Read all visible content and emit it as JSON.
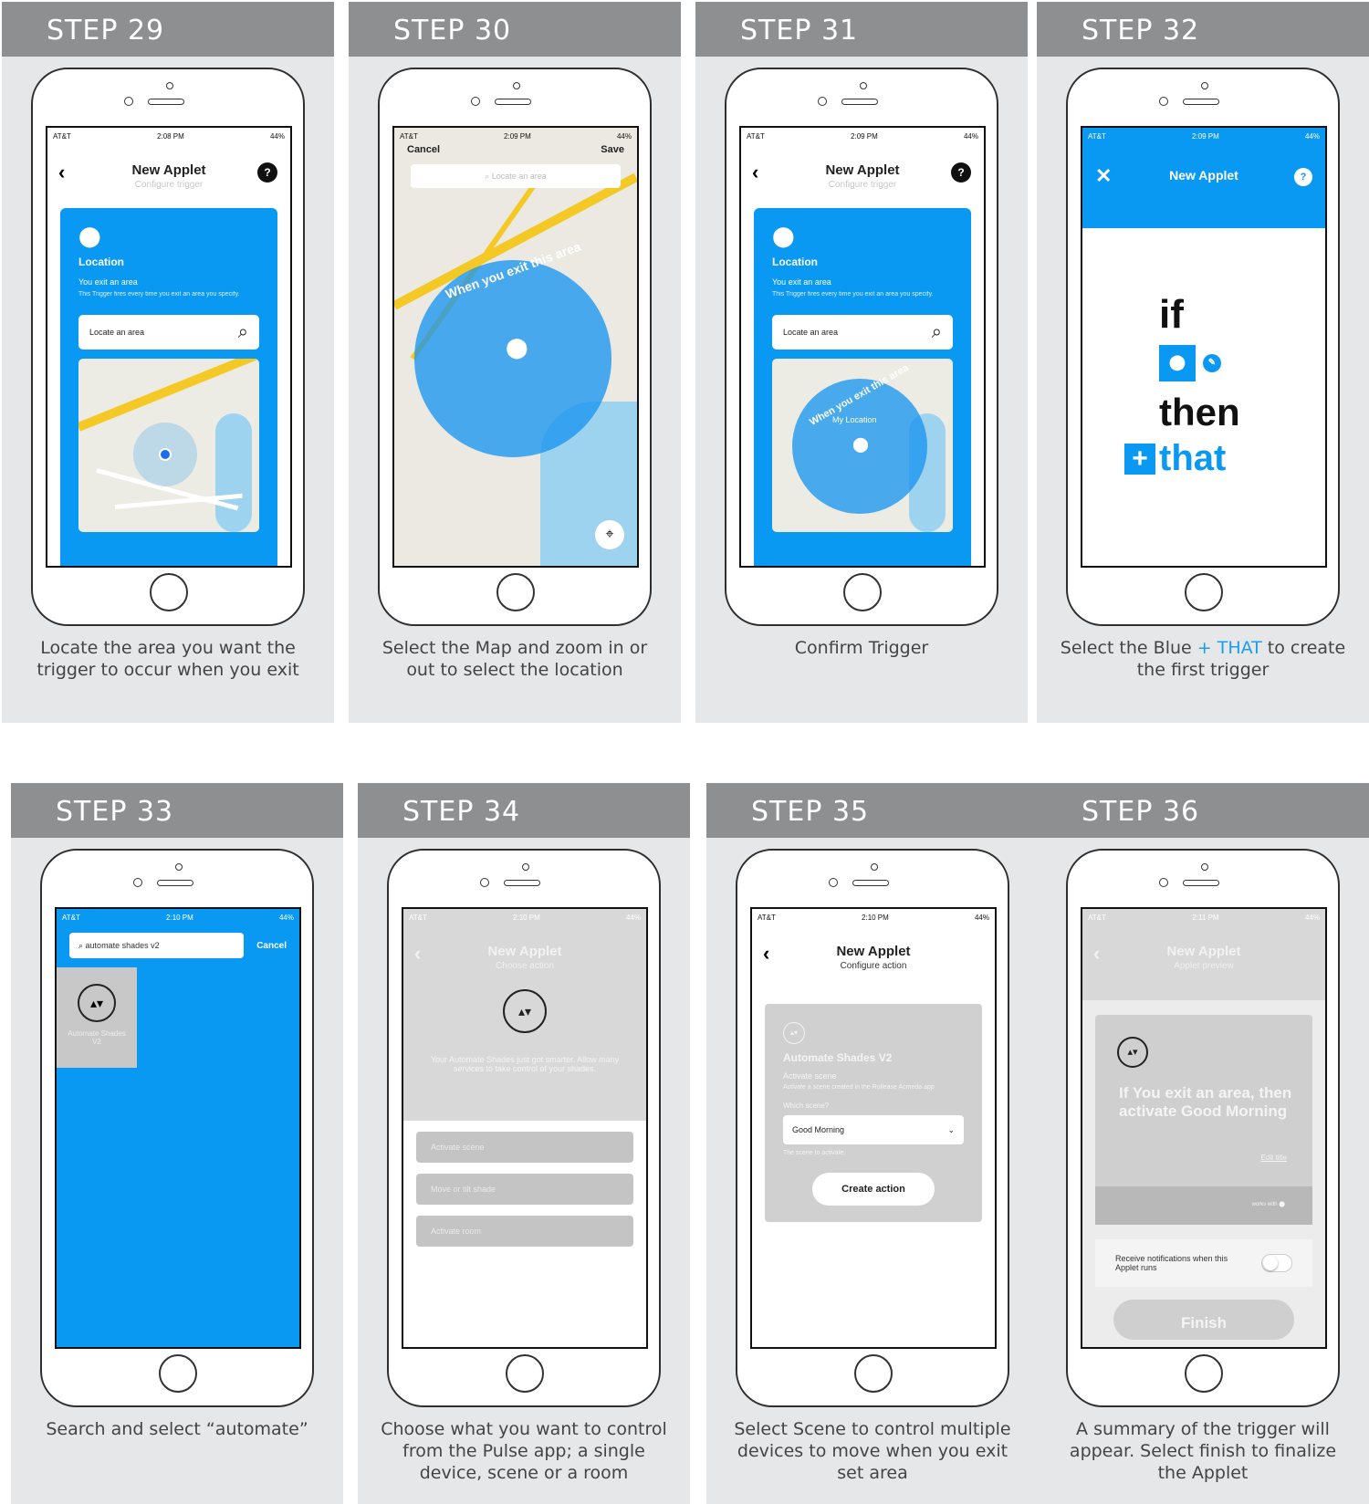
{
  "steps": [
    {
      "label": "STEP 29",
      "caption": "Locate the area you want the trigger to occur when you exit"
    },
    {
      "label": "STEP 30",
      "caption": "Select the Map and zoom in or out to select the location"
    },
    {
      "label": "STEP 31",
      "caption": "Confirm Trigger"
    },
    {
      "label": "STEP 32",
      "caption_pre": "Select the Blue ",
      "caption_accent": "+ THAT",
      "caption_post": " to create the first trigger"
    },
    {
      "label": "STEP 33",
      "caption": "Search and select “automate”"
    },
    {
      "label": "STEP 34",
      "caption": "Choose what you want to control from the Pulse app; a single device, scene or a room"
    },
    {
      "label": "STEP 35",
      "caption": "Select Scene to control multiple devices to move when you exit set area"
    },
    {
      "label": "STEP 36",
      "caption": "A summary of the trigger will appear. Select finish to finalize the Applet"
    }
  ],
  "status": {
    "carrier": "AT&T",
    "battery": "44%",
    "time_29": "2:08 PM",
    "time_30": "2:09 PM",
    "time_31": "2:09 PM",
    "time_32": "2:09 PM",
    "time_33": "2:10 PM",
    "time_34": "2:10 PM",
    "time_35": "2:10 PM",
    "time_36": "2:11 PM"
  },
  "applet": {
    "title": "New Applet",
    "configure_trigger": "Configure trigger",
    "choose_action": "Choose action",
    "configure_action": "Configure action",
    "applet_preview": "Applet preview",
    "help": "?"
  },
  "trigger": {
    "service": "Location",
    "name": "You exit an area",
    "description": "This Trigger fires every time you exit an area you specify.",
    "locate_placeholder": "Locate an area",
    "circle_text": "When you exit this area",
    "my_location": "My Location"
  },
  "map30": {
    "cancel": "Cancel",
    "save": "Save",
    "search_placeholder": "Locate an area"
  },
  "ifthen": {
    "if": "if",
    "then": "then",
    "that": "that"
  },
  "search": {
    "query": "automate shades v2",
    "cancel": "Cancel",
    "result": "Automate Shades V2"
  },
  "choose": {
    "description": "Your Automate Shades just got smarter. Allow many services to take control of your shades.",
    "options": [
      "Activate scene",
      "Move or tilt shade",
      "Activate room"
    ]
  },
  "action": {
    "service": "Automate Shades V2",
    "name": "Activate scene",
    "description": "Activate a scene created in the Rollease Acmeda app",
    "field_label": "Which scene?",
    "selected_scene": "Good Morning",
    "help": "The scene to activate.",
    "button": "Create action"
  },
  "preview": {
    "summary": "If You exit an area, then activate Good Morning",
    "edit_title": "Edit title",
    "works_with": "works with",
    "notify": "Receive notifications when this Applet runs",
    "finish": "Finish"
  },
  "colors": {
    "ifttt_blue": "#0a99f2",
    "header_grey": "#8e8f91",
    "card_bg": "#e6e7e9"
  }
}
